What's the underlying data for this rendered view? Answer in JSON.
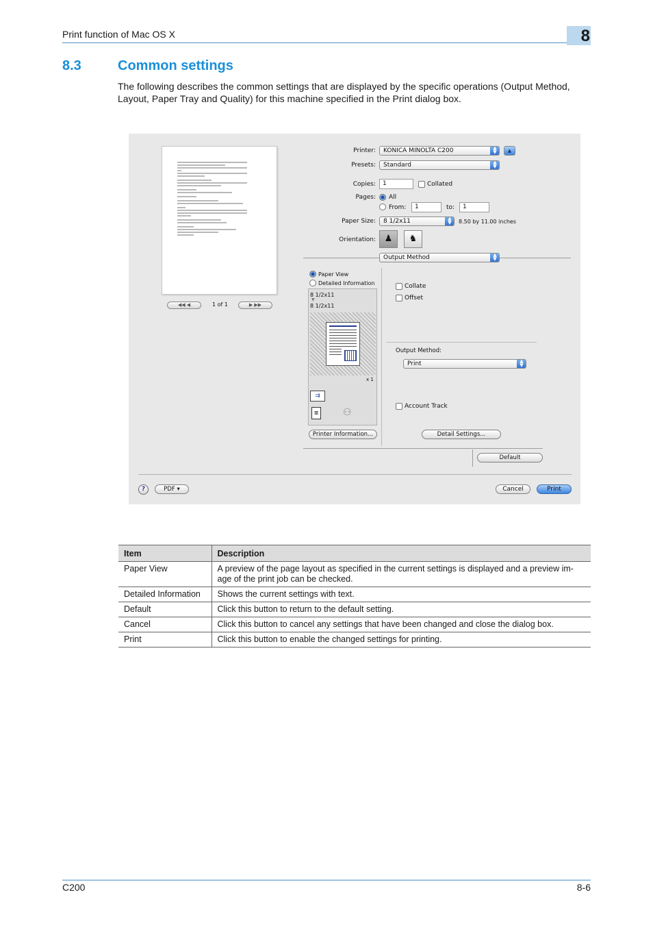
{
  "header": {
    "title": "Print function of Mac OS X",
    "chapter": "8"
  },
  "section": {
    "number": "8.3",
    "title": "Common settings",
    "intro": "The following describes the common settings that are displayed by the specific operations (Output Method, Layout, Paper Tray and Quality) for this machine specified in the Print dialog box."
  },
  "dialog": {
    "printer_label": "Printer:",
    "printer_value": "KONICA MINOLTA C200",
    "presets_label": "Presets:",
    "presets_value": "Standard",
    "copies_label": "Copies:",
    "copies_value": "1",
    "collated_label": "Collated",
    "pages_label": "Pages:",
    "pages_all": "All",
    "pages_from": "From:",
    "from_value": "1",
    "pages_to": "to:",
    "to_value": "1",
    "paper_size_label": "Paper Size:",
    "paper_size_value": "8 1/2x11",
    "paper_size_dims": "8.50 by 11.00 inches",
    "orientation_label": "Orientation:",
    "panel_value": "Output Method",
    "paper_view": "Paper View",
    "detailed_info": "Detailed Information",
    "info_size_1": "8 1/2x11",
    "info_size_2": "8 1/2x11",
    "copies_count": "x 1",
    "collate": "Collate",
    "offset": "Offset",
    "output_method_label": "Output Method:",
    "output_method_value": "Print",
    "account_track": "Account Track",
    "printer_info_btn": "Printer Information...",
    "detail_settings_btn": "Detail Settings...",
    "default_btn": "Default",
    "nav_page": "1 of 1",
    "nav_prev": "◀◀  ◀",
    "nav_next": "▶  ▶▶",
    "help": "?",
    "pdf_btn": "PDF ▾",
    "cancel_btn": "Cancel",
    "print_btn": "Print"
  },
  "table": {
    "headers": [
      "Item",
      "Description"
    ],
    "rows": [
      [
        "Paper View",
        "A preview of the page layout as specified in the current settings is displayed and a preview im-age of the print job can be checked."
      ],
      [
        "Detailed Information",
        "Shows the current settings with text."
      ],
      [
        "Default",
        "Click this button to return to the default setting."
      ],
      [
        "Cancel",
        "Click this button to cancel any settings that have been changed and close the dialog box."
      ],
      [
        "Print",
        "Click this button to enable the changed settings for printing."
      ]
    ]
  },
  "footer": {
    "model": "C200",
    "page": "8-6"
  }
}
